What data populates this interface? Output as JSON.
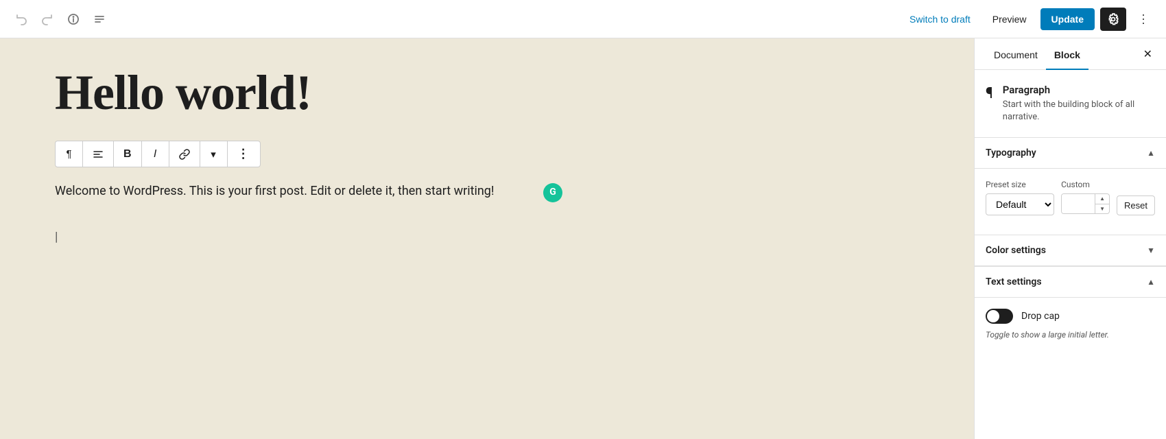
{
  "toolbar": {
    "switch_draft_label": "Switch to draft",
    "preview_label": "Preview",
    "update_label": "Update"
  },
  "editor": {
    "title": "Hello world!",
    "content": "Welcome to WordPress. This is your first post. Edit or delete it, then start writing!"
  },
  "block_toolbar": {
    "paragraph_icon": "¶",
    "align_icon": "≡",
    "bold_icon": "B",
    "italic_icon": "I",
    "link_icon": "🔗",
    "more_icon": "⌄",
    "options_icon": "⋮"
  },
  "sidebar": {
    "document_tab": "Document",
    "block_tab": "Block",
    "block_name": "Paragraph",
    "block_desc": "Start with the building block of all narrative.",
    "typography_label": "Typography",
    "preset_size_label": "Preset size",
    "custom_label": "Custom",
    "preset_default": "Default",
    "reset_label": "Reset",
    "color_settings_label": "Color settings",
    "text_settings_label": "Text settings",
    "drop_cap_label": "Drop cap",
    "drop_cap_desc": "Toggle to show a large initial letter."
  }
}
